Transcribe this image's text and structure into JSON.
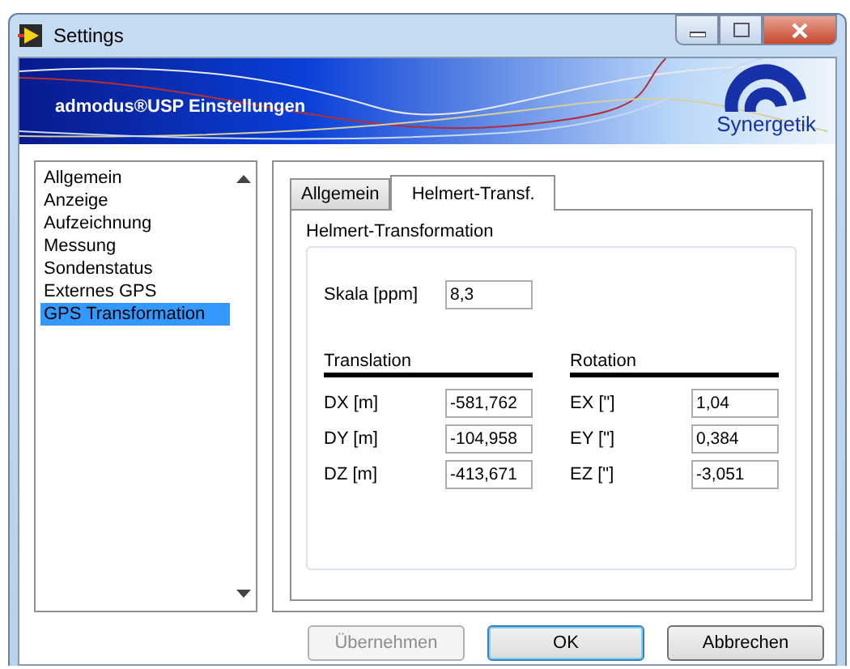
{
  "window": {
    "title": "Settings"
  },
  "banner": {
    "title": "admodus®USP Einstellungen",
    "logo_text": "Synergetik"
  },
  "sidebar": {
    "items": [
      {
        "label": "Allgemein",
        "selected": false
      },
      {
        "label": "Anzeige",
        "selected": false
      },
      {
        "label": "Aufzeichnung",
        "selected": false
      },
      {
        "label": "Messung",
        "selected": false
      },
      {
        "label": "Sondenstatus",
        "selected": false
      },
      {
        "label": "Externes GPS",
        "selected": false
      },
      {
        "label": "GPS Transformation",
        "selected": true
      }
    ]
  },
  "tabs": [
    {
      "label": "Allgemein",
      "selected": false
    },
    {
      "label": "Helmert-Transf.",
      "selected": true
    }
  ],
  "group": {
    "title": "Helmert-Transformation",
    "scale": {
      "label": "Skala [ppm]",
      "value": "8,3"
    },
    "sections": [
      {
        "title": "Translation",
        "fields": [
          {
            "label": "DX [m]",
            "value": "-581,762"
          },
          {
            "label": "DY [m]",
            "value": "-104,958"
          },
          {
            "label": "DZ [m]",
            "value": "-413,671"
          }
        ]
      },
      {
        "title": "Rotation",
        "fields": [
          {
            "label": "EX [\"]",
            "value": "1,04"
          },
          {
            "label": "EY [\"]",
            "value": "0,384"
          },
          {
            "label": "EZ [\"]",
            "value": "-3,051"
          }
        ]
      }
    ]
  },
  "buttons": [
    {
      "label": "Übernehmen",
      "disabled": true,
      "default": false
    },
    {
      "label": "OK",
      "disabled": false,
      "default": true
    },
    {
      "label": "Abbrechen",
      "disabled": false,
      "default": false
    }
  ]
}
